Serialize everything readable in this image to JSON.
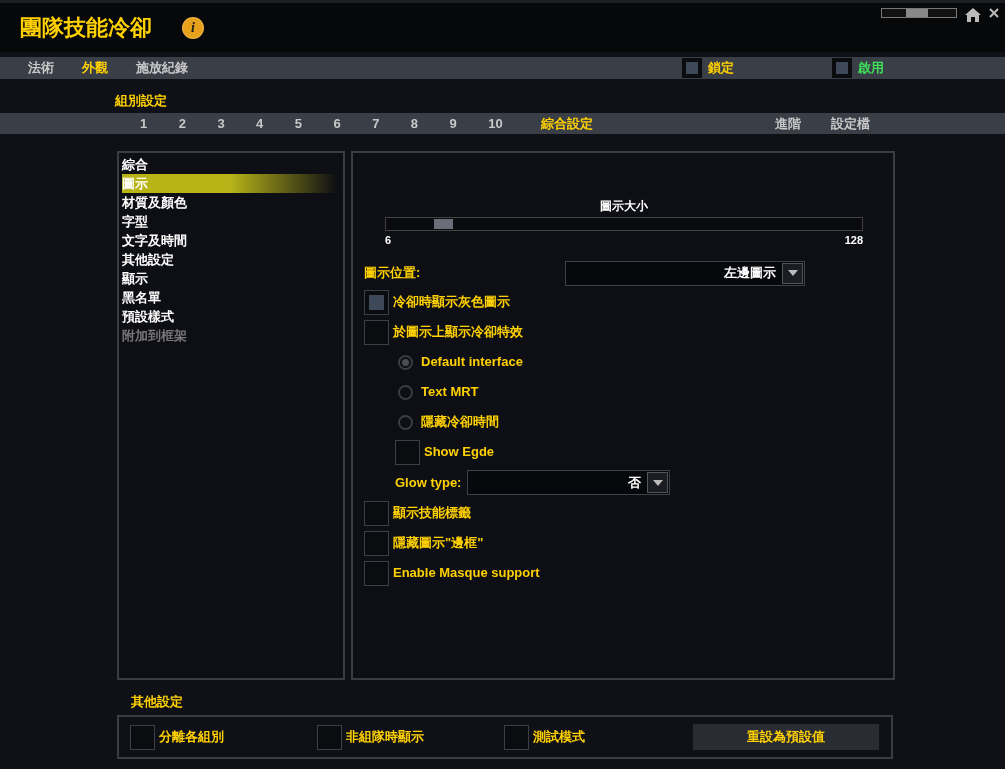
{
  "window": {
    "title": "團隊技能冷卻",
    "info_button": "i"
  },
  "tabs": [
    {
      "label": "法術",
      "selected": false
    },
    {
      "label": "外觀",
      "selected": true
    },
    {
      "label": "施放紀錄",
      "selected": false
    }
  ],
  "lock": {
    "label": "鎖定",
    "checked": true
  },
  "enable": {
    "label": "啟用",
    "checked": true
  },
  "group_section": {
    "title": "組別設定",
    "tabs": [
      {
        "label": "1",
        "selected": false
      },
      {
        "label": "2",
        "selected": false
      },
      {
        "label": "3",
        "selected": false
      },
      {
        "label": "4",
        "selected": false
      },
      {
        "label": "5",
        "selected": false
      },
      {
        "label": "6",
        "selected": false
      },
      {
        "label": "7",
        "selected": false
      },
      {
        "label": "8",
        "selected": false
      },
      {
        "label": "9",
        "selected": false
      },
      {
        "label": "10",
        "selected": false
      },
      {
        "label": "綜合設定",
        "selected": true
      }
    ],
    "right_tabs": [
      {
        "label": "進階",
        "selected": false
      },
      {
        "label": "設定檔",
        "selected": false
      }
    ]
  },
  "sidebar": {
    "items": [
      {
        "label": "綜合",
        "selected": false,
        "disabled": false
      },
      {
        "label": "圖示",
        "selected": true,
        "disabled": false
      },
      {
        "label": "材質及顏色",
        "selected": false,
        "disabled": false
      },
      {
        "label": "字型",
        "selected": false,
        "disabled": false
      },
      {
        "label": "文字及時間",
        "selected": false,
        "disabled": false
      },
      {
        "label": "其他設定",
        "selected": false,
        "disabled": false
      },
      {
        "label": "顯示",
        "selected": false,
        "disabled": false
      },
      {
        "label": "黑名單",
        "selected": false,
        "disabled": false
      },
      {
        "label": "預設樣式",
        "selected": false,
        "disabled": false
      },
      {
        "label": "附加到框架",
        "selected": false,
        "disabled": true
      }
    ]
  },
  "icon_settings": {
    "slider": {
      "label": "圖示大小",
      "min": "6",
      "max": "128",
      "level": 0.1
    },
    "position": {
      "label": "圖示位置:",
      "value": "左邊圖示"
    },
    "options": [
      {
        "kind": "checkbox",
        "label": "冷卻時顯示灰色圖示",
        "checked": true
      },
      {
        "kind": "checkbox",
        "label": "於圖示上顯示冷卻特效",
        "checked": false,
        "children": [
          {
            "kind": "radio",
            "label": "Default interface",
            "selected": true
          },
          {
            "kind": "radio",
            "label": "Text MRT",
            "selected": false
          },
          {
            "kind": "radio",
            "label": "隱藏冷卻時間",
            "selected": false
          },
          {
            "kind": "checkbox",
            "label": "Show Egde",
            "checked": false
          },
          {
            "kind": "dropdown",
            "label": "Glow type:",
            "value": "否"
          }
        ]
      },
      {
        "kind": "checkbox",
        "label": "顯示技能標籤",
        "checked": false
      },
      {
        "kind": "checkbox",
        "label": "隱藏圖示\"邊框\"",
        "checked": false
      },
      {
        "kind": "checkbox",
        "label": "Enable Masque support",
        "checked": false
      }
    ]
  },
  "other_settings": {
    "title": "其他設定",
    "checkboxes": [
      {
        "label": "分離各組別",
        "checked": false
      },
      {
        "label": "非組隊時顯示",
        "checked": false
      },
      {
        "label": "測試模式",
        "checked": false
      }
    ],
    "reset_button": "重設為預設值"
  }
}
